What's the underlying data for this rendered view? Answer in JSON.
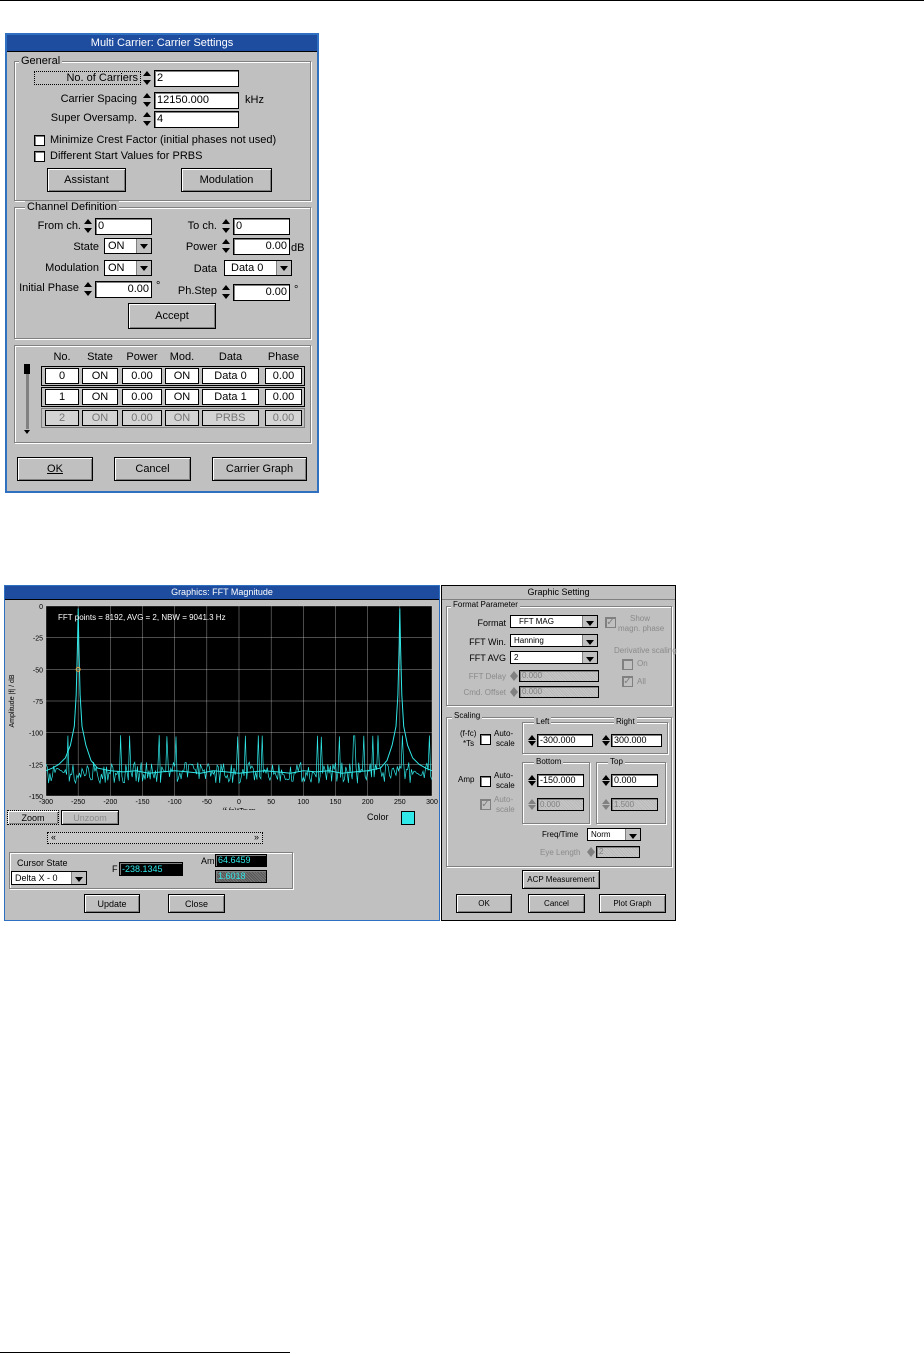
{
  "carrier_dialog": {
    "title": "Multi Carrier: Carrier Settings",
    "general": {
      "label": "General",
      "carriers_label": "No. of Carriers",
      "carriers_value": "2",
      "spacing_label": "Carrier Spacing",
      "spacing_value": "12150.000",
      "spacing_unit": "kHz",
      "oversamp_label": "Super Oversamp.",
      "oversamp_value": "4",
      "crest_label": "Minimize Crest Factor (initial phases not used)",
      "prbs_label": "Different Start Values for PRBS",
      "assistant_btn": "Assistant",
      "modulation_btn": "Modulation"
    },
    "channel": {
      "label": "Channel Definition",
      "from_label": "From ch.",
      "from_value": "0",
      "to_label": "To ch.",
      "to_value": "0",
      "state_label": "State",
      "state_value": "ON",
      "power_label": "Power",
      "power_value": "0.00",
      "power_unit": "dB",
      "modulation_label": "Modulation",
      "modulation_value": "ON",
      "data_label": "Data",
      "data_value": "Data 0",
      "phase_label": "Initial Phase",
      "phase_value": "0.00",
      "phase_unit": "°",
      "phstep_label": "Ph.Step",
      "phstep_value": "0.00",
      "phstep_unit": "°",
      "accept_btn": "Accept"
    },
    "table": {
      "headers": [
        "No.",
        "State",
        "Power",
        "Mod.",
        "Data",
        "Phase"
      ],
      "rows": [
        [
          "0",
          "ON",
          "0.00",
          "ON",
          "Data 0",
          "0.00"
        ],
        [
          "1",
          "ON",
          "0.00",
          "ON",
          "Data 1",
          "0.00"
        ],
        [
          "2",
          "ON",
          "0.00",
          "ON",
          "PRBS",
          "0.00"
        ]
      ]
    },
    "ok_btn": "OK",
    "cancel_btn": "Cancel",
    "graph_btn": "Carrier Graph"
  },
  "graphics_window": {
    "title": "Graphics: FFT Magnitude",
    "info_text": "FFT points = 8192, AVG = 2, NBW = 9041.3 Hz",
    "ylabel": "Amplitude |f| / dB",
    "xlabel": "(f-fc)*Tsym",
    "color_label": "Color",
    "zoom_btn": "Zoom",
    "unzoom_btn": "Unzoom",
    "cursor_state_label": "Cursor State",
    "cursor_state_value": "Delta X - 0",
    "f_label": "F",
    "f_value": "-238.1345",
    "am_label": "Am",
    "am_value": "64.6459",
    "am_value2": "1.6018",
    "update_btn": "Update",
    "close_btn": "Close",
    "scroll_left": "«",
    "scroll_right": "»",
    "colors": {
      "trace": "#30e8e8",
      "grid": "#d8d8d8",
      "background": "#000000",
      "marker": "#e8a040"
    }
  },
  "chart_data": {
    "type": "line",
    "title": "",
    "xlabel": "(f-fc)*Tsym",
    "ylabel": "Amplitude |f| / dB",
    "xlim": [
      -300,
      300
    ],
    "ylim": [
      -150,
      0
    ],
    "xticks": [
      "-300",
      "-250",
      "-200",
      "-150",
      "-100",
      "-50",
      "0",
      "50",
      "100",
      "150",
      "200",
      "250",
      "300"
    ],
    "yticks": [
      "0",
      "-25",
      "-50",
      "-75",
      "-100",
      "-125",
      "-150"
    ],
    "grid": true,
    "series": [
      {
        "x": [
          -300,
          -290,
          -280,
          -270,
          -262,
          -256,
          -253,
          -251,
          -250,
          -249,
          -247,
          -244,
          -238,
          -230,
          -220,
          -200,
          -180,
          -160,
          -140,
          -120,
          -100,
          -80,
          -60,
          -40,
          -20,
          0,
          20,
          40,
          60,
          80,
          100,
          120,
          140,
          160,
          180,
          200,
          220,
          230,
          238,
          244,
          247,
          249,
          250,
          251,
          253,
          256,
          262,
          270,
          280,
          290,
          300
        ],
        "y": [
          -130,
          -128,
          -125,
          -120,
          -110,
          -95,
          -70,
          -30,
          -2,
          -30,
          -70,
          -95,
          -110,
          -122,
          -128,
          -130,
          -131,
          -130,
          -132,
          -131,
          -130,
          -131,
          -132,
          -130,
          -131,
          -132,
          -131,
          -130,
          -131,
          -132,
          -130,
          -131,
          -130,
          -132,
          -131,
          -130,
          -128,
          -122,
          -110,
          -95,
          -70,
          -30,
          -2,
          -30,
          -70,
          -95,
          -110,
          -120,
          -125,
          -128,
          -130
        ]
      }
    ],
    "marker": {
      "x": -250,
      "y": -50
    }
  },
  "graphic_settings": {
    "title": "Graphic Setting",
    "format_param_label": "Format Parameter",
    "format_label": "Format",
    "format_value": "FFT MAG",
    "show_label_1": "Show",
    "show_label_2": "magn. phase",
    "fftwin_label": "FFT Win.",
    "fftwin_value": "Hanning",
    "fftavg_label": "FFT AVG",
    "fftavg_value": "2",
    "fftdelay_label": "FFT Delay",
    "fftdelay_value": "0.000",
    "cmdoffset_label": "Cmd. Offset",
    "cmdoffset_value": "0.000",
    "derivative_label": "Derivative scaling",
    "on_label": "On",
    "all_label": "All",
    "scaling_label": "Scaling",
    "fts_label_1": "(f-fc)",
    "fts_label_2": "*Ts",
    "auto_label_1": "Auto-",
    "auto_label_2": "scale",
    "left_label": "Left",
    "left_value": "-300.000",
    "right_label": "Right",
    "right_value": "300.000",
    "amp_label": "Amp",
    "bottom_label": "Bottom",
    "bottom_value": "-150.000",
    "top_label": "Top",
    "top_value": "0.000",
    "bottom_value2": "0.000",
    "top_value2": "1.500",
    "freqtime_label": "Freq/Time",
    "freqtime_value": "Norm",
    "eyelength_label": "Eye Length",
    "eyelength_value": "2",
    "acp_btn": "ACP Measurement",
    "ok_btn": "OK",
    "cancel_btn": "Cancel",
    "plot_btn": "Plot Graph"
  }
}
